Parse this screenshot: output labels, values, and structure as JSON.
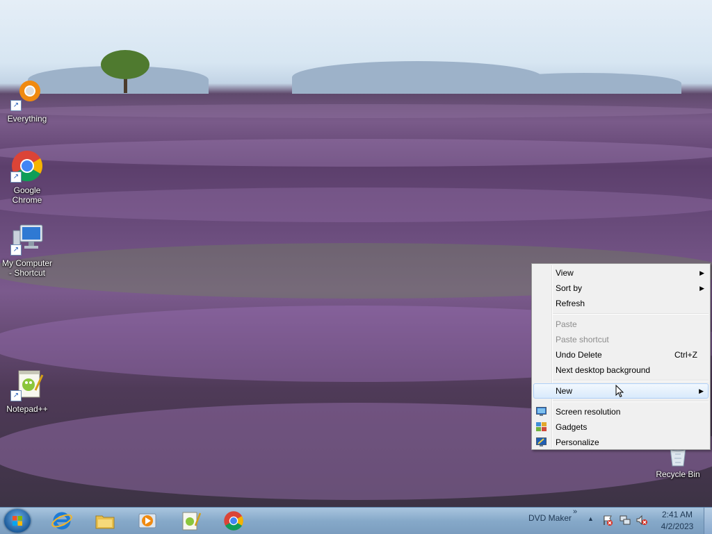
{
  "desktop": {
    "icons": [
      {
        "label": "Everything",
        "icon": "everything-icon"
      },
      {
        "label": "Google Chrome",
        "icon": "chrome-icon"
      },
      {
        "label": "My Computer - Shortcut",
        "icon": "computer-icon"
      },
      {
        "label": "Notepad++",
        "icon": "notepadpp-icon"
      },
      {
        "label": "Recycle Bin",
        "icon": "recycle-bin-icon"
      }
    ]
  },
  "context_menu": {
    "items": [
      {
        "label": "View",
        "submenu": true
      },
      {
        "label": "Sort by",
        "submenu": true
      },
      {
        "label": "Refresh"
      },
      {
        "label": "Paste",
        "disabled": true
      },
      {
        "label": "Paste shortcut",
        "disabled": true
      },
      {
        "label": "Undo Delete",
        "shortcut": "Ctrl+Z"
      },
      {
        "label": "Next desktop background"
      },
      {
        "label": "New",
        "submenu": true,
        "highlighted": true
      },
      {
        "label": "Screen resolution",
        "icon": "screen-resolution-icon"
      },
      {
        "label": "Gadgets",
        "icon": "gadgets-icon"
      },
      {
        "label": "Personalize",
        "icon": "personalize-icon"
      }
    ],
    "submenu_arrow": "▶"
  },
  "taskbar": {
    "pinned": [
      "internet-explorer-icon",
      "file-explorer-icon",
      "media-player-icon",
      "notepadpp-icon",
      "chrome-icon"
    ],
    "toolbar_label": "DVD Maker",
    "toolbar_chevron": "»",
    "tray_arrow": "▲",
    "tray_icons": [
      "action-center-icon",
      "network-icon",
      "volume-muted-icon"
    ],
    "clock": {
      "time": "2:41 AM",
      "date": "4/2/2023"
    }
  },
  "colors": {
    "taskbar": "#86a9c9",
    "menu_background": "#f0f0f0",
    "menu_highlight_border": "#aecff7",
    "lavender": "#7b5a8d"
  }
}
